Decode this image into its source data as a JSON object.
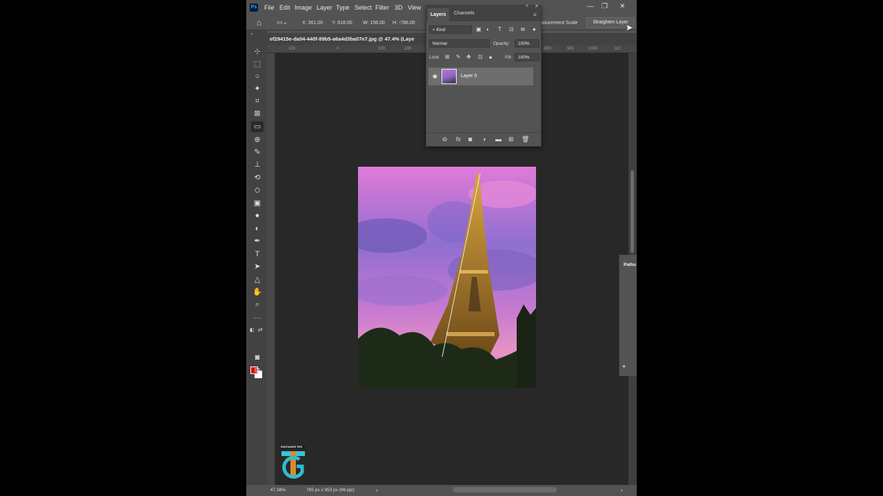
{
  "menu": {
    "logo": "Ps",
    "items": [
      "File",
      "Edit",
      "Image",
      "Layer",
      "Type",
      "Select",
      "Filter",
      "3D",
      "View"
    ]
  },
  "window_controls": {
    "minimize": "—",
    "restore": "❐",
    "close": "✕"
  },
  "options": {
    "x": "X: 361.00",
    "y": "Y: 818.00",
    "w": "W: 156.00",
    "h": "H: -786.00",
    "measurement_scale": "asurement Scale",
    "straighten": "Straighten Layer"
  },
  "document": {
    "tab_title": "ef29415e-da04-440f-89b5-a6a4d3ba07e7.jpg @ 47.4% (Laye",
    "ruler_ticks_left": [
      "100",
      "0",
      "100",
      "200"
    ],
    "ruler_ticks_right": [
      "800",
      "900",
      "1000",
      "110"
    ]
  },
  "status": {
    "zoom": "47.38%",
    "doc_info": "765 px x 953 px (96 ppi)"
  },
  "layers_panel": {
    "tabs": [
      "Layers",
      "Channels"
    ],
    "filter_kind": "Kind",
    "blend_mode": "Normal",
    "opacity_label": "Opacity:",
    "opacity_value": "100%",
    "lock_label": "Lock:",
    "fill_label": "Fill:",
    "fill_value": "100%",
    "layers": [
      {
        "name": "Layer 0",
        "visible": true
      }
    ]
  },
  "paths_panel": {
    "label": "Paths"
  },
  "watermark": {
    "text": "TG",
    "subtitle": "PHOTOSHOP TIPS"
  },
  "colors": {
    "foreground": "#e30d0d",
    "background": "#ffffff",
    "app_bg": "#535353",
    "canvas_bg": "#282828"
  }
}
